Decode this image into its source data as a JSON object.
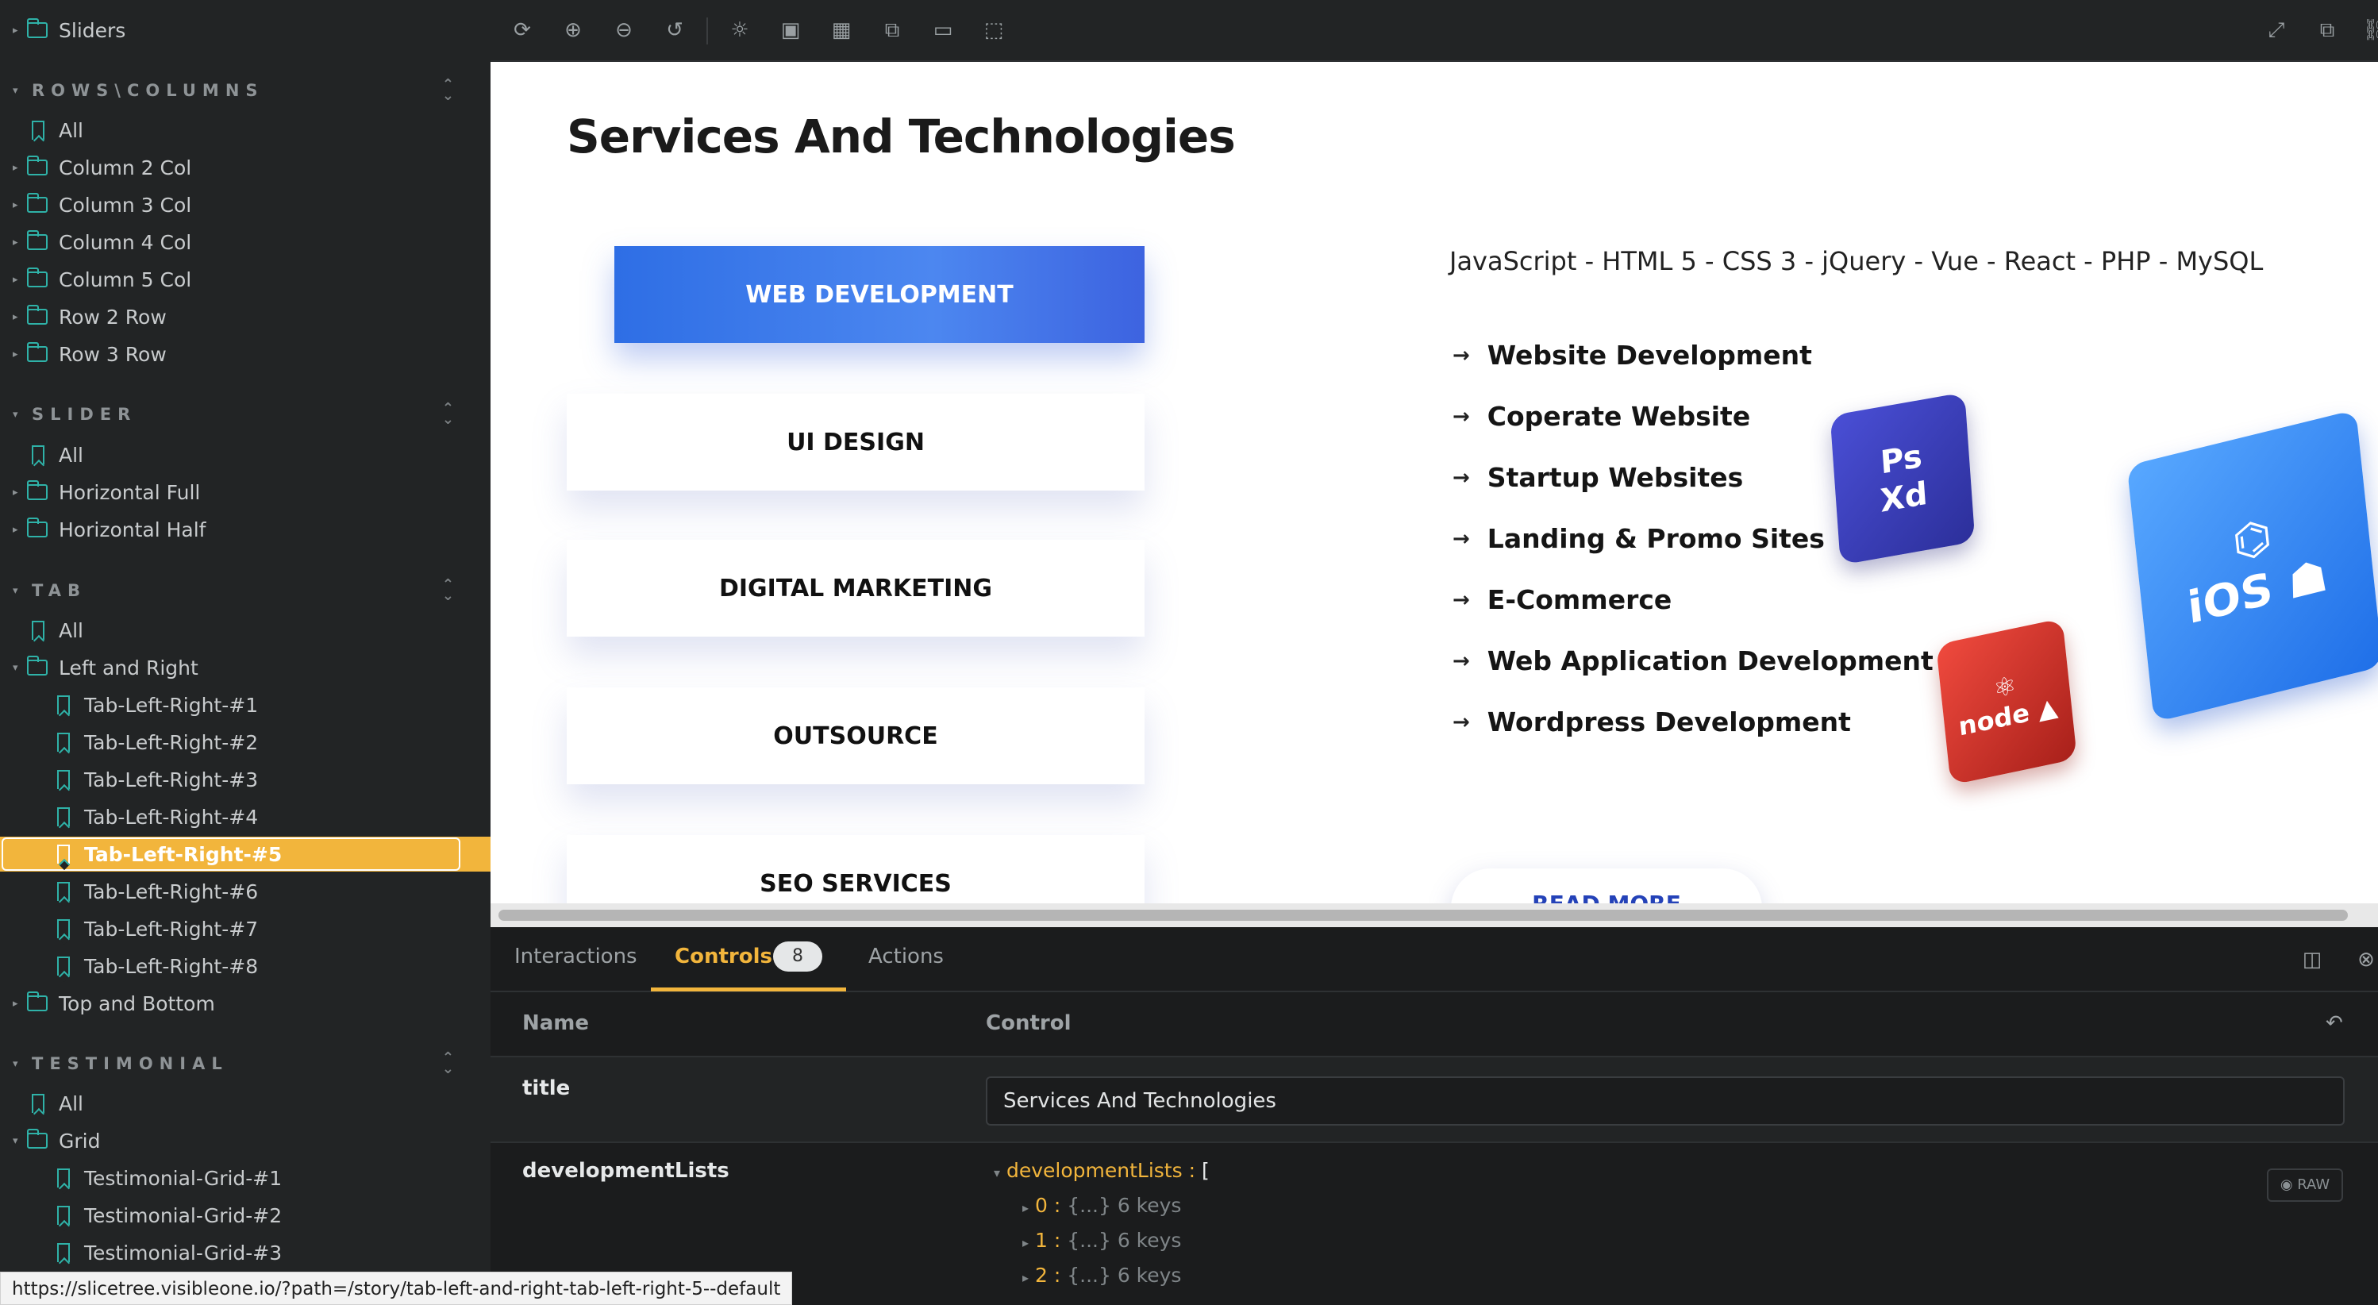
{
  "sidebar": {
    "top_item": "Sliders",
    "sections": [
      {
        "title": "ROWS\\COLUMNS",
        "items": [
          "All",
          "Column 2 Col",
          "Column 3 Col",
          "Column 4 Col",
          "Column 5 Col",
          "Row 2 Row",
          "Row 3 Row"
        ]
      },
      {
        "title": "SLIDER",
        "items": [
          "All",
          "Horizontal Full",
          "Horizontal Half"
        ]
      },
      {
        "title": "TAB",
        "items": [
          "All",
          "Left and Right",
          "Tab-Left-Right-#1",
          "Tab-Left-Right-#2",
          "Tab-Left-Right-#3",
          "Tab-Left-Right-#4",
          "Tab-Left-Right-#5",
          "Tab-Left-Right-#6",
          "Tab-Left-Right-#7",
          "Tab-Left-Right-#8",
          "Top and Bottom"
        ]
      },
      {
        "title": "TESTIMONIAL",
        "items": [
          "All",
          "Grid",
          "Testimonial-Grid-#1",
          "Testimonial-Grid-#2",
          "Testimonial-Grid-#3"
        ]
      }
    ]
  },
  "toolbar": {
    "icons": [
      "sync-icon",
      "zoom-in-icon",
      "zoom-out-icon",
      "zoom-reset-icon",
      "background-icon",
      "image-icon",
      "grid-icon",
      "measure-icon",
      "outline-icon",
      "viewport-icon"
    ],
    "right_icons": [
      "fullscreen-icon",
      "open-new-tab-icon",
      "copy-link-icon"
    ]
  },
  "preview": {
    "title": "Services And Technologies",
    "tabs": [
      "WEB DEVELOPMENT",
      "UI DESIGN",
      "DIGITAL MARKETING",
      "OUTSOURCE",
      "SEO SERVICES"
    ],
    "tech_line": "JavaScript - HTML 5 - CSS 3 - jQuery - Vue - React - PHP - MySQL",
    "dev_items": [
      "Website Development",
      "Coperate Website",
      "Startup Websites",
      "Landing & Promo Sites",
      "E-Commerce",
      "Web Application Development",
      "Wordpress Development"
    ],
    "read_more": "READ MORE",
    "cubes": {
      "ps_label": "Ps",
      "xd_label": "Xd",
      "ios_label": "iOS",
      "node_label": "node"
    }
  },
  "addons": {
    "tabs": [
      "Interactions",
      "Controls",
      "Actions"
    ],
    "controls_count": "8",
    "columns": {
      "name": "Name",
      "control": "Control"
    },
    "rows": {
      "title_name": "title",
      "title_value": "Services And Technologies",
      "dev_name": "developmentLists",
      "json_root": "developmentLists :",
      "json_bracket": "[",
      "json_items": [
        {
          "index": "0 :",
          "summary": "{...} 6 keys"
        },
        {
          "index": "1 :",
          "summary": "{...} 6 keys"
        },
        {
          "index": "2 :",
          "summary": "{...} 6 keys"
        }
      ],
      "raw_label": "RAW"
    }
  },
  "status_url": "https://slicetree.visibleone.io/?path=/story/tab-left-and-right-tab-left-right-5--default",
  "colors": {
    "accent": "#f2b53c",
    "teal": "#2fb2a8",
    "tab_blue": "#3b7be8"
  }
}
